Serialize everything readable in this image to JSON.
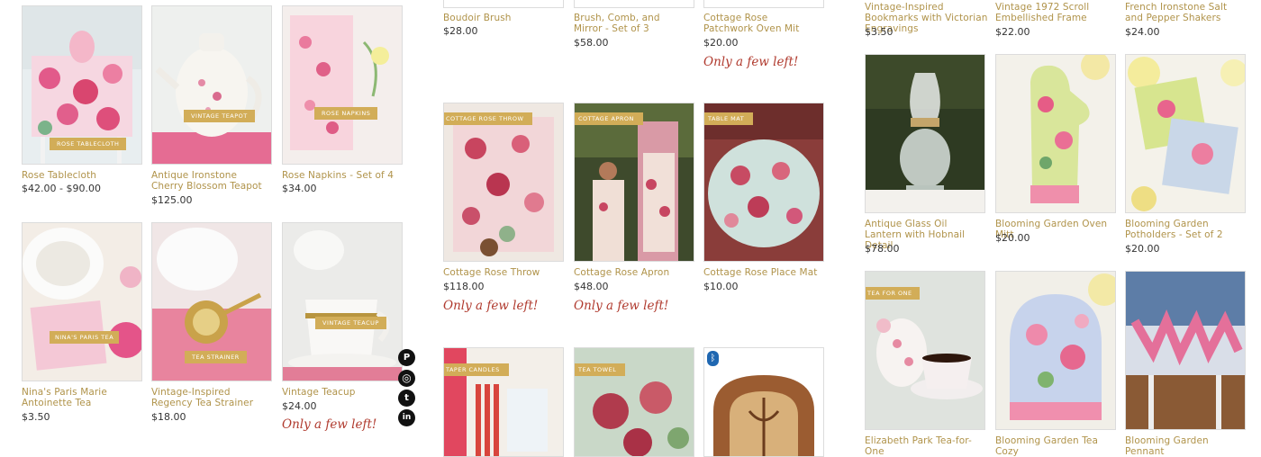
{
  "products": {
    "rose_tablecloth": {
      "name": "Rose Tablecloth",
      "price": "$42.00 - $90.00",
      "label": "ROSE TABLECLOTH"
    },
    "ironstone_teapot": {
      "name": "Antique Ironstone Cherry Blossom Teapot",
      "price": "$125.00",
      "label": "VINTAGE TEAPOT"
    },
    "rose_napkins": {
      "name": "Rose Napkins - Set of 4",
      "price": "$34.00",
      "label": "ROSE NAPKINS"
    },
    "paris_tea": {
      "name": "Nina's Paris Marie Antoinette Tea",
      "price": "$3.50",
      "label": "NINA'S PARIS TEA"
    },
    "tea_strainer": {
      "name": "Vintage-Inspired Regency Tea Strainer",
      "price": "$18.00",
      "label": "TEA STRAINER"
    },
    "vintage_teacup": {
      "name": "Vintage Teacup",
      "price": "$24.00",
      "label": "VINTAGE TEACUP",
      "stock": "Only a few left!"
    },
    "boudoir_brush": {
      "name": "Boudoir Brush",
      "price": "$28.00"
    },
    "brush_comb_mirror": {
      "name": "Brush, Comb, and Mirror - Set of 3",
      "price": "$58.00"
    },
    "patchwork_mitt": {
      "name": "Cottage Rose Patchwork Oven Mit",
      "price": "$20.00",
      "stock": "Only a few left!"
    },
    "cottage_throw": {
      "name": "Cottage Rose Throw",
      "price": "$118.00",
      "label": "COTTAGE ROSE THROW",
      "stock": "Only a few left!"
    },
    "cottage_apron": {
      "name": "Cottage Rose Apron",
      "price": "$48.00",
      "label": "COTTAGE APRON",
      "stock": "Only a few left!"
    },
    "cottage_placemat": {
      "name": "Cottage Rose Place Mat",
      "price": "$10.00",
      "label": "TABLE MAT"
    },
    "taper_candles": {
      "label": "TAPER CANDLES"
    },
    "tea_towel": {
      "label": "TEA TOWEL"
    },
    "radio": {},
    "bookmarks": {
      "name": "Vintage-Inspired Bookmarks with Victorian Engravings",
      "price": "$3.50"
    },
    "scroll_frame": {
      "name": "Vintage 1972 Scroll Embellished Frame",
      "price": "$22.00"
    },
    "salt_pepper": {
      "name": "French Ironstone Salt and Pepper Shakers",
      "price": "$24.00"
    },
    "oil_lantern": {
      "name": "Antique Glass Oil Lantern with Hobnail Detail",
      "price": "$78.00"
    },
    "oven_mitt": {
      "name": "Blooming Garden Oven Mitt",
      "price": "$20.00"
    },
    "potholders": {
      "name": "Blooming Garden Potholders - Set of 2",
      "price": "$20.00"
    },
    "tea_for_one": {
      "name": "Elizabeth Park Tea-for-One",
      "label": "TEA FOR ONE"
    },
    "tea_cozy": {
      "name": "Blooming Garden Tea Cozy"
    },
    "pennant": {
      "name": "Blooming Garden Pennant"
    }
  },
  "social": {
    "pinterest": "P",
    "instagram": "◎",
    "tumblr": "t",
    "linkedin": "in"
  },
  "colors": {
    "name": "#b0934a",
    "price": "#333333",
    "stock": "#b03a2e",
    "banner": "#d2ad58"
  }
}
